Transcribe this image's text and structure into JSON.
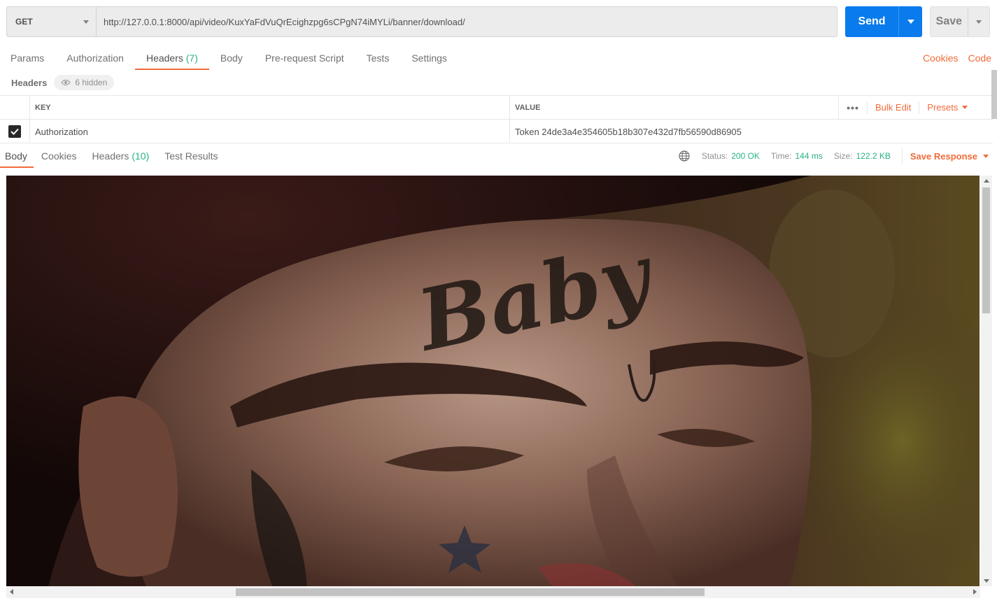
{
  "request": {
    "method": "GET",
    "url": "http://127.0.0.1:8000/api/video/KuxYaFdVuQrEcighzpg6sCPgN74iMYLi/banner/download/",
    "send_label": "Send",
    "save_label": "Save"
  },
  "request_tabs": [
    {
      "label": "Params"
    },
    {
      "label": "Authorization"
    },
    {
      "label": "Headers",
      "count": "(7)"
    },
    {
      "label": "Body"
    },
    {
      "label": "Pre-request Script"
    },
    {
      "label": "Tests"
    },
    {
      "label": "Settings"
    }
  ],
  "right_links": {
    "cookies": "Cookies",
    "code": "Code"
  },
  "headers_section": {
    "title": "Headers",
    "hidden": "6 hidden"
  },
  "headers_table": {
    "col_key": "KEY",
    "col_value": "VALUE",
    "bulk_edit": "Bulk Edit",
    "presets": "Presets",
    "rows": [
      {
        "checked": true,
        "key": "Authorization",
        "value": "Token 24de3a4e354605b18b307e432d7fb56590d86905"
      }
    ]
  },
  "response_tabs": [
    {
      "label": "Body"
    },
    {
      "label": "Cookies"
    },
    {
      "label": "Headers",
      "count": "(10)"
    },
    {
      "label": "Test Results"
    }
  ],
  "response_meta": {
    "status_label": "Status:",
    "status": "200 OK",
    "time_label": "Time:",
    "time": "144 ms",
    "size_label": "Size:",
    "size": "122.2 KB",
    "save_response": "Save Response"
  },
  "response_image": {
    "tattoo_text": "Baby"
  },
  "colors": {
    "accent": "#f26b3a",
    "send": "#097bed",
    "success": "#26b47f"
  },
  "icons": [
    "chevron-down-icon",
    "eye-icon",
    "globe-icon",
    "check-icon",
    "more-dots-icon"
  ]
}
